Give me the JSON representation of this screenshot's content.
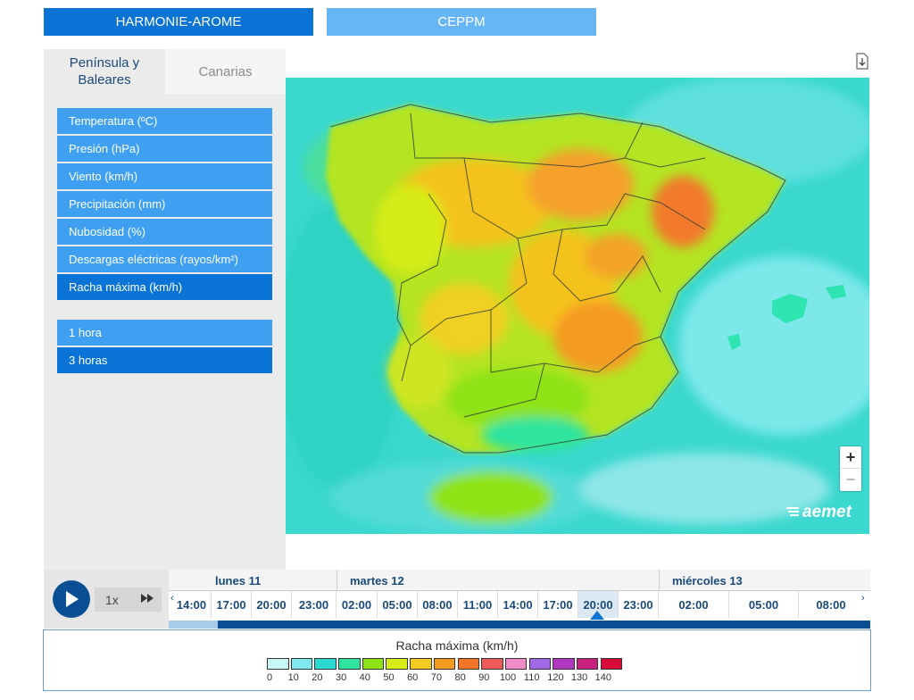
{
  "models": [
    {
      "label": "HARMONIE-AROME",
      "active": true
    },
    {
      "label": "CEPPM",
      "active": false
    }
  ],
  "regions": [
    {
      "label": "Península y Baleares",
      "active": true
    },
    {
      "label": "Canarias",
      "active": false
    }
  ],
  "variables": [
    {
      "label": "Temperatura (ºC)",
      "selected": false
    },
    {
      "label": "Presión (hPa)",
      "selected": false
    },
    {
      "label": "Viento (km/h)",
      "selected": false
    },
    {
      "label": "Precipitación (mm)",
      "selected": false
    },
    {
      "label": "Nubosidad (%)",
      "selected": false
    },
    {
      "label": "Descargas eléctricas (rayos/km²)",
      "selected": false
    },
    {
      "label": "Racha máxima (km/h)",
      "selected": true
    }
  ],
  "steps": [
    {
      "label": "1 hora",
      "selected": false
    },
    {
      "label": "3 horas",
      "selected": true
    }
  ],
  "map": {
    "zoom_in": "+",
    "zoom_out": "−",
    "brand": "aemet"
  },
  "player": {
    "speed": "1x"
  },
  "timeline": {
    "days": [
      "lunes 11",
      "martes 12",
      "miércoles 13"
    ],
    "hours": [
      "14:00",
      "17:00",
      "20:00",
      "23:00",
      "02:00",
      "05:00",
      "08:00",
      "11:00",
      "14:00",
      "17:00",
      "20:00",
      "23:00",
      "02:00",
      "05:00",
      "08:00"
    ],
    "current_hour_index": 10,
    "prev_arrow": "‹",
    "next_arrow": "›"
  },
  "legend": {
    "title": "Racha máxima (km/h)",
    "colors": [
      "#c8f5f5",
      "#7ee8ee",
      "#2cd9d2",
      "#2ee49f",
      "#8ee313",
      "#d6ec13",
      "#f4cc22",
      "#f59b20",
      "#f2762a",
      "#ee5a5a",
      "#f28ac8",
      "#a06ae6",
      "#b038c0",
      "#c8207e",
      "#d80a3a"
    ],
    "labels": [
      "0",
      "10",
      "20",
      "30",
      "40",
      "50",
      "60",
      "70",
      "80",
      "90",
      "100",
      "110",
      "120",
      "130",
      "140"
    ]
  }
}
